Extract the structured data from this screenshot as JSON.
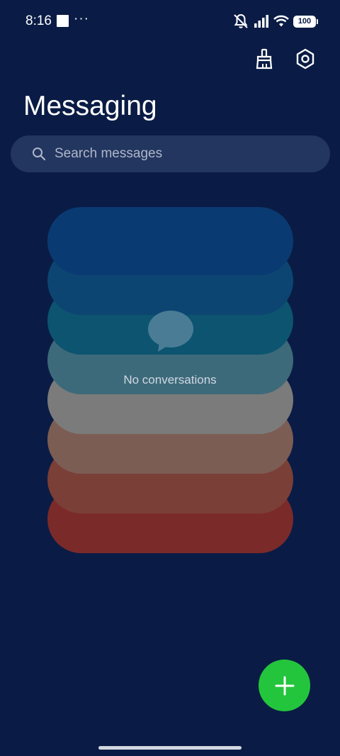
{
  "status_bar": {
    "time": "8:16",
    "dots": "···",
    "battery": "100",
    "icons": [
      "notification-square-icon",
      "mute-bell-icon",
      "signal-icon",
      "wifi-icon",
      "battery-icon"
    ]
  },
  "header": {
    "title": "Messaging",
    "actions": [
      "broom-clean-icon",
      "settings-hexagon-icon"
    ]
  },
  "search": {
    "placeholder": "Search messages",
    "icon": "search-icon"
  },
  "empty_state": {
    "message": "No conversations",
    "icon": "chat-bubble-icon",
    "stack_colors": [
      "#7b2a2a",
      "#7a3f37",
      "#7c5d53",
      "#7b7b7b",
      "#3d6a7a",
      "#0c5470",
      "#0c4572",
      "#0a3a72"
    ]
  },
  "fab": {
    "icon": "plus-icon",
    "color": "#23c53c"
  },
  "colors": {
    "background": "#0a1c45",
    "search_bg": "#233660",
    "accent": "#23c53c"
  }
}
